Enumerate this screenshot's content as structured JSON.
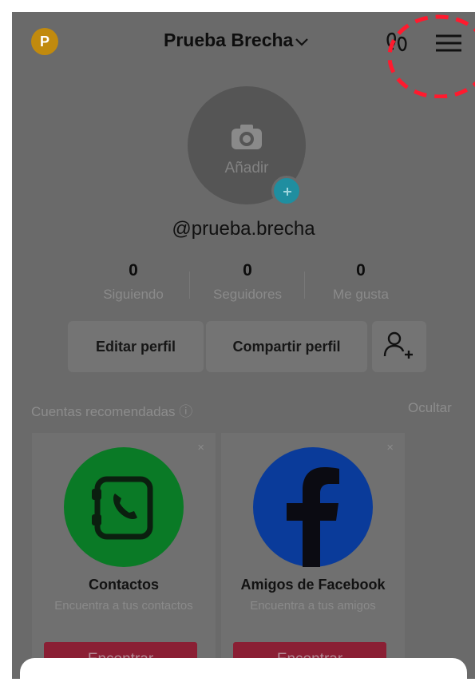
{
  "header": {
    "avatar_letter": "P",
    "account_name": "Prueba Brecha",
    "dropdown_icon": "chevron-down-icon",
    "footprint_icon": "footprints-icon",
    "menu_icon": "hamburger-menu-icon"
  },
  "profile": {
    "photo_add_label": "Añadir",
    "handle": "@prueba.brecha"
  },
  "stats": [
    {
      "value": "0",
      "label": "Siguiendo"
    },
    {
      "value": "0",
      "label": "Seguidores"
    },
    {
      "value": "0",
      "label": "Me gusta"
    }
  ],
  "actions": {
    "edit_profile": "Editar perfil",
    "share_profile": "Compartir perfil",
    "add_friend_icon": "add-person-icon"
  },
  "recommended": {
    "title": "Cuentas recomendadas ⓘ",
    "hide_label": "Ocultar",
    "cards": [
      {
        "name": "Contactos",
        "subtitle": "Encuentra a tus contactos",
        "button": "Encontrar",
        "close": "×",
        "icon": "contacts-phone-icon",
        "icon_color": "#0a7a26"
      },
      {
        "name": "Amigos de Facebook",
        "subtitle": "Encuentra a tus amigos",
        "button": "Encontrar",
        "close": "×",
        "icon": "facebook-icon",
        "icon_color": "#0a3b9a"
      }
    ]
  },
  "colors": {
    "overlay": "#6a6a6a",
    "find_button": "#8a1f34",
    "annotation": "#ff1a2e"
  }
}
